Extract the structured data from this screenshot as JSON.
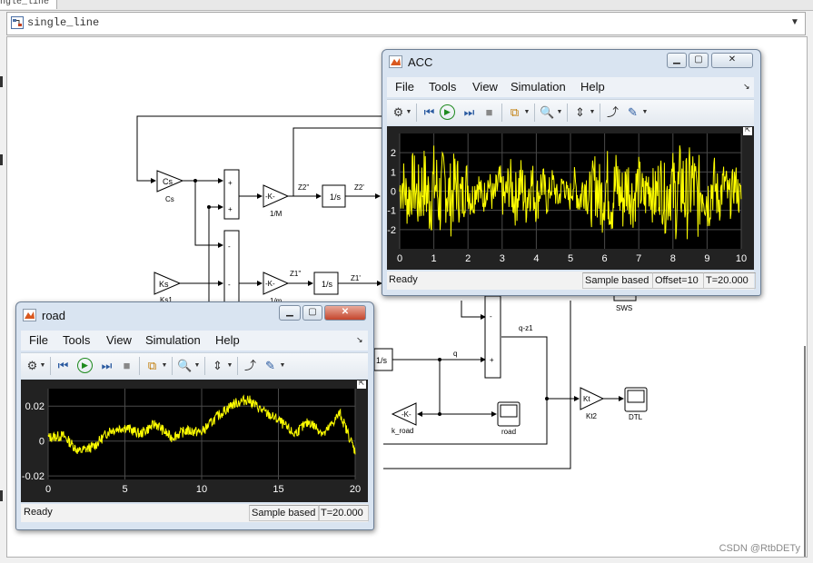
{
  "tab": {
    "label": "ngle_line"
  },
  "address": {
    "path": "single_line"
  },
  "diagram": {
    "blocks": {
      "cs": "Cs",
      "cs_label": "Cs",
      "ks": "Ks",
      "ks_label": "Ks1",
      "gain_m": "-K-",
      "gain_m_label": "1/M",
      "gain_mu": "-K-",
      "gain_mu_label": "1/m",
      "int1": "1/s",
      "int2": "1/s",
      "int3": "1/s",
      "k_road": "-K-",
      "k_road_label": "k_road",
      "kt": "Kt",
      "kt_label": "Kt2",
      "road_scope_label": "road",
      "dtl_scope_label": "DTL",
      "sws_label": "SWS"
    },
    "signals": {
      "z2dd": "Z2''",
      "z2d": "Z2'",
      "z1dd": "Z1''",
      "z1d": "Z1'",
      "q": "q",
      "qz1": "q-z1"
    },
    "sum_signs": {
      "plus": "+",
      "minus": "-"
    }
  },
  "acc_window": {
    "title": "ACC",
    "menus": [
      "File",
      "Tools",
      "View",
      "Simulation",
      "Help"
    ],
    "status": {
      "ready": "Ready",
      "mode": "Sample based",
      "offset": "Offset=10",
      "time": "T=20.000"
    },
    "chart_data": {
      "type": "line",
      "xlim": [
        0,
        10
      ],
      "ylim": [
        -3,
        3
      ],
      "x_ticks": [
        "0",
        "1",
        "2",
        "3",
        "4",
        "5",
        "6",
        "7",
        "8",
        "9",
        "10"
      ],
      "y_ticks": [
        "2",
        "1",
        "0",
        "-1",
        "-2"
      ],
      "series": [
        {
          "color": "#ffff00",
          "description": "noisy acceleration signal, amplitude about ±1.5, peaks near ±2.3"
        }
      ]
    }
  },
  "road_window": {
    "title": "road",
    "menus": [
      "File",
      "Tools",
      "View",
      "Simulation",
      "Help"
    ],
    "status": {
      "ready": "Ready",
      "mode": "Sample based",
      "time": "T=20.000"
    },
    "chart_data": {
      "type": "line",
      "xlim": [
        0,
        20
      ],
      "ylim": [
        -0.022,
        0.03
      ],
      "x_ticks": [
        "0",
        "5",
        "10",
        "15",
        "20"
      ],
      "y_ticks": [
        "0.02",
        "0",
        "-0.02"
      ],
      "series": [
        {
          "color": "#ffff00",
          "points": [
            [
              0,
              0.002
            ],
            [
              1,
              0.003
            ],
            [
              2,
              -0.006
            ],
            [
              3,
              -0.003
            ],
            [
              4,
              0.006
            ],
            [
              5,
              0.008
            ],
            [
              6,
              0.004
            ],
            [
              7,
              0.01
            ],
            [
              8,
              0.002
            ],
            [
              9,
              0.006
            ],
            [
              10,
              0.005
            ],
            [
              11,
              0.014
            ],
            [
              12,
              0.021
            ],
            [
              13,
              0.024
            ],
            [
              14,
              0.017
            ],
            [
              15,
              0.012
            ],
            [
              16,
              0.004
            ],
            [
              17,
              0.011
            ],
            [
              18,
              0.004
            ],
            [
              19,
              0.016
            ],
            [
              20,
              -0.006
            ]
          ]
        }
      ]
    }
  },
  "watermark": "CSDN @RtbDETy",
  "colors": {
    "window_frame": "#d9e4f1",
    "plot_bg": "#000000",
    "trace": "#ffff00",
    "grid": "#4a4a4a"
  }
}
